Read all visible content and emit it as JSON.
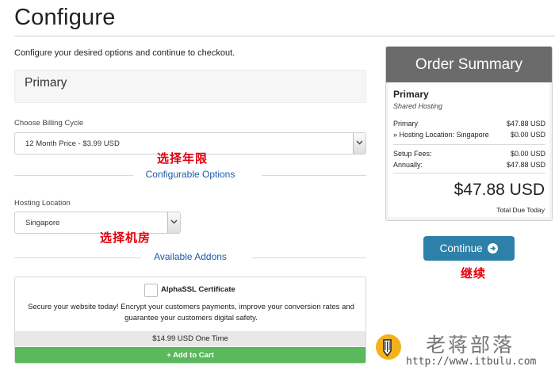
{
  "page": {
    "title": "Configure",
    "intro": "Configure your desired options and continue to checkout."
  },
  "product": {
    "name": "Primary"
  },
  "billing": {
    "label": "Choose Billing Cycle",
    "selected": "12 Month Price - $3.99 USD"
  },
  "configurable_options": {
    "heading": "Configurable Options",
    "hosting_location_label": "Hosting Location",
    "hosting_location_selected": "Singapore"
  },
  "annotations": {
    "choose_term": "选择年限",
    "choose_datacenter": "选择机房",
    "continue": "继续"
  },
  "addons": {
    "heading": "Available Addons",
    "items": [
      {
        "name": "AlphaSSL Certificate",
        "checked": false,
        "description": "Secure your website today! Encrypt your customers payments, improve your conversion rates and guarantee your customers digital safety.",
        "price": "$14.99 USD One Time",
        "add_label": "Add to Cart"
      }
    ]
  },
  "summary": {
    "heading": "Order Summary",
    "product_name": "Primary",
    "product_group": "Shared Hosting",
    "lines": [
      {
        "label": "Primary",
        "value": "$47.88 USD"
      },
      {
        "label": "» Hosting Location: Singapore",
        "value": "$0.00 USD"
      }
    ],
    "fees": [
      {
        "label": "Setup Fees:",
        "value": "$0.00 USD"
      },
      {
        "label": "Annually:",
        "value": "$47.88 USD"
      }
    ],
    "total": "$47.88 USD",
    "total_label": "Total Due Today"
  },
  "actions": {
    "continue_label": "Continue"
  },
  "watermark": {
    "name": "老蒋部落",
    "url": "http://www.itbulu.com"
  },
  "colors": {
    "link_blue": "#1e5aa8",
    "annotation_red": "#e3000b",
    "continue_button": "#2d80a9",
    "add_to_cart_green": "#5cb85c",
    "summary_header": "#6b6b6b"
  },
  "icons": [
    "chevron-down-icon",
    "plus-icon",
    "arrow-circle-right-icon",
    "pen-logo-icon"
  ]
}
